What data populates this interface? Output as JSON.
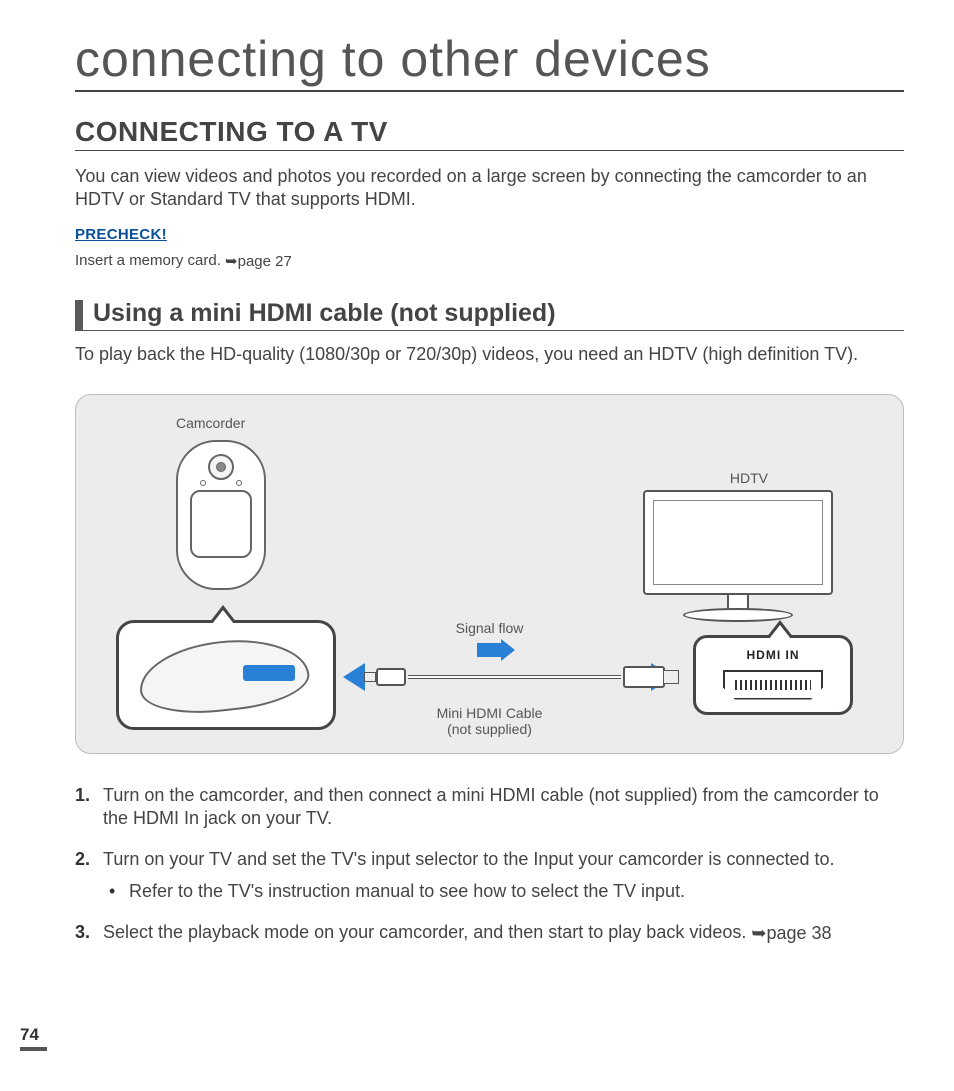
{
  "page_title": "connecting to other devices",
  "section_title": "CONNECTING TO A TV",
  "intro": "You can view videos and photos you recorded on a large screen by connecting the camcorder to an HDTV or Standard TV that supports HDMI.",
  "precheck": {
    "label": "PRECHECK!",
    "text": "Insert a memory card. ",
    "ref": "➥page 27"
  },
  "subsection": {
    "heading": "Using a mini HDMI cable (not supplied)",
    "text": "To play back the HD-quality (1080/30p or 720/30p) videos, you need an HDTV (high definition TV)."
  },
  "diagram": {
    "camcorder_label": "Camcorder",
    "hdtv_label": "HDTV",
    "signal_flow": "Signal flow",
    "cable_label_1": "Mini HDMI Cable",
    "cable_label_2": "(not supplied)",
    "hdmi_in": "HDMI IN"
  },
  "steps": [
    {
      "text": "Turn on the camcorder, and then connect a mini HDMI cable (not supplied) from the camcorder to the HDMI In jack on your TV."
    },
    {
      "text": "Turn on your TV and set the TV's input selector to the Input your camcorder is connected to.",
      "bullets": [
        "Refer to the TV's instruction manual to see how to select the TV input."
      ]
    },
    {
      "text": "Select the playback mode on your camcorder, and then start to play back videos. ",
      "ref": "➥page 38"
    }
  ],
  "page_number": "74"
}
